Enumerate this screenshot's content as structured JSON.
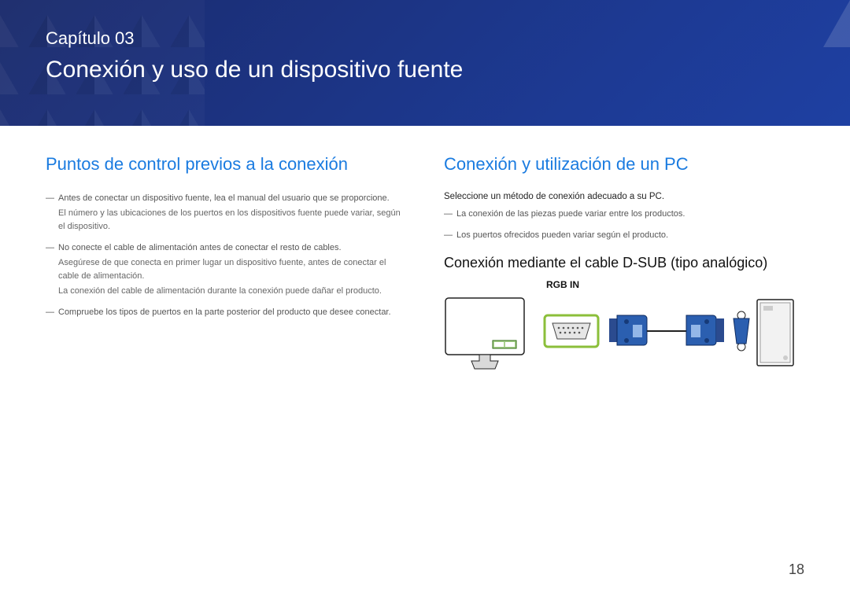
{
  "chapter": {
    "label": "Capítulo 03",
    "title": "Conexión y uso de un dispositivo fuente"
  },
  "left": {
    "heading": "Puntos de control previos a la conexión",
    "notes": [
      {
        "main": "Antes de conectar un dispositivo fuente, lea el manual del usuario que se proporcione.",
        "sub": "El número y las ubicaciones de los puertos en los dispositivos fuente puede variar, según el dispositivo."
      },
      {
        "main": "No conecte el cable de alimentación antes de conectar el resto de cables.",
        "sub": "Asegúrese de que conecta en primer lugar un dispositivo fuente, antes de conectar el cable de alimentación.",
        "sub2": "La conexión del cable de alimentación durante la conexión puede dañar el producto."
      },
      {
        "main": "Compruebe los tipos de puertos en la parte posterior del producto que desee conectar."
      }
    ]
  },
  "right": {
    "heading": "Conexión y utilización de un PC",
    "intro": "Seleccione un método de conexión adecuado a su PC.",
    "notes": [
      {
        "main": "La conexión de las piezas puede variar entre los productos."
      },
      {
        "main": "Los puertos ofrecidos pueden variar según el producto."
      }
    ],
    "subheading": "Conexión mediante el cable D-SUB (tipo analógico)",
    "port_label": "RGB IN"
  },
  "page_number": "18"
}
